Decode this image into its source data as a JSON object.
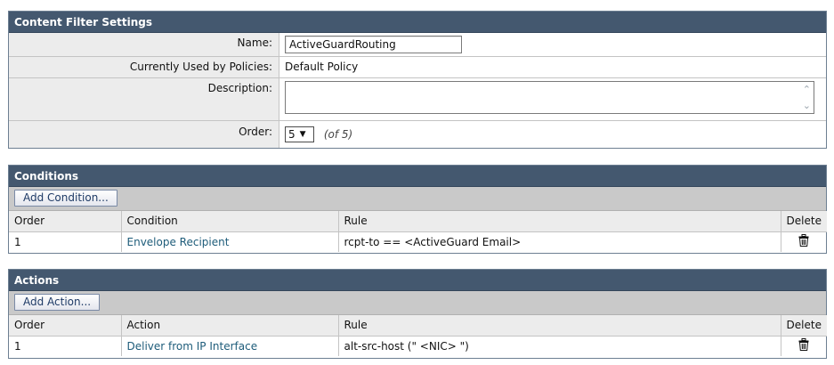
{
  "settings": {
    "title": "Content Filter Settings",
    "name_label": "Name:",
    "name_value": "ActiveGuardRouting",
    "used_label": "Currently Used by Policies:",
    "used_value": "Default Policy",
    "description_label": "Description:",
    "description_value": "",
    "order_label": "Order:",
    "order_value": "5",
    "order_of": "(of 5)"
  },
  "conditions": {
    "title": "Conditions",
    "add_button": "Add Condition...",
    "columns": [
      "Order",
      "Condition",
      "Rule",
      "Delete"
    ],
    "rows": [
      {
        "order": "1",
        "condition": "Envelope Recipient",
        "rule": "rcpt-to == <ActiveGuard Email>"
      }
    ]
  },
  "actions": {
    "title": "Actions",
    "add_button": "Add Action...",
    "columns": [
      "Order",
      "Action",
      "Rule",
      "Delete"
    ],
    "rows": [
      {
        "order": "1",
        "action": "Deliver from IP Interface",
        "rule": "alt-src-host (\" <NIC> \")"
      }
    ]
  },
  "icons": {
    "delete": "trash-icon",
    "select_arrow": "chevron-down-icon",
    "scroll_up": "chevron-up-icon",
    "scroll_down": "chevron-down-icon"
  },
  "colors": {
    "header_bg": "#44586f",
    "link": "#1e5c7a"
  }
}
